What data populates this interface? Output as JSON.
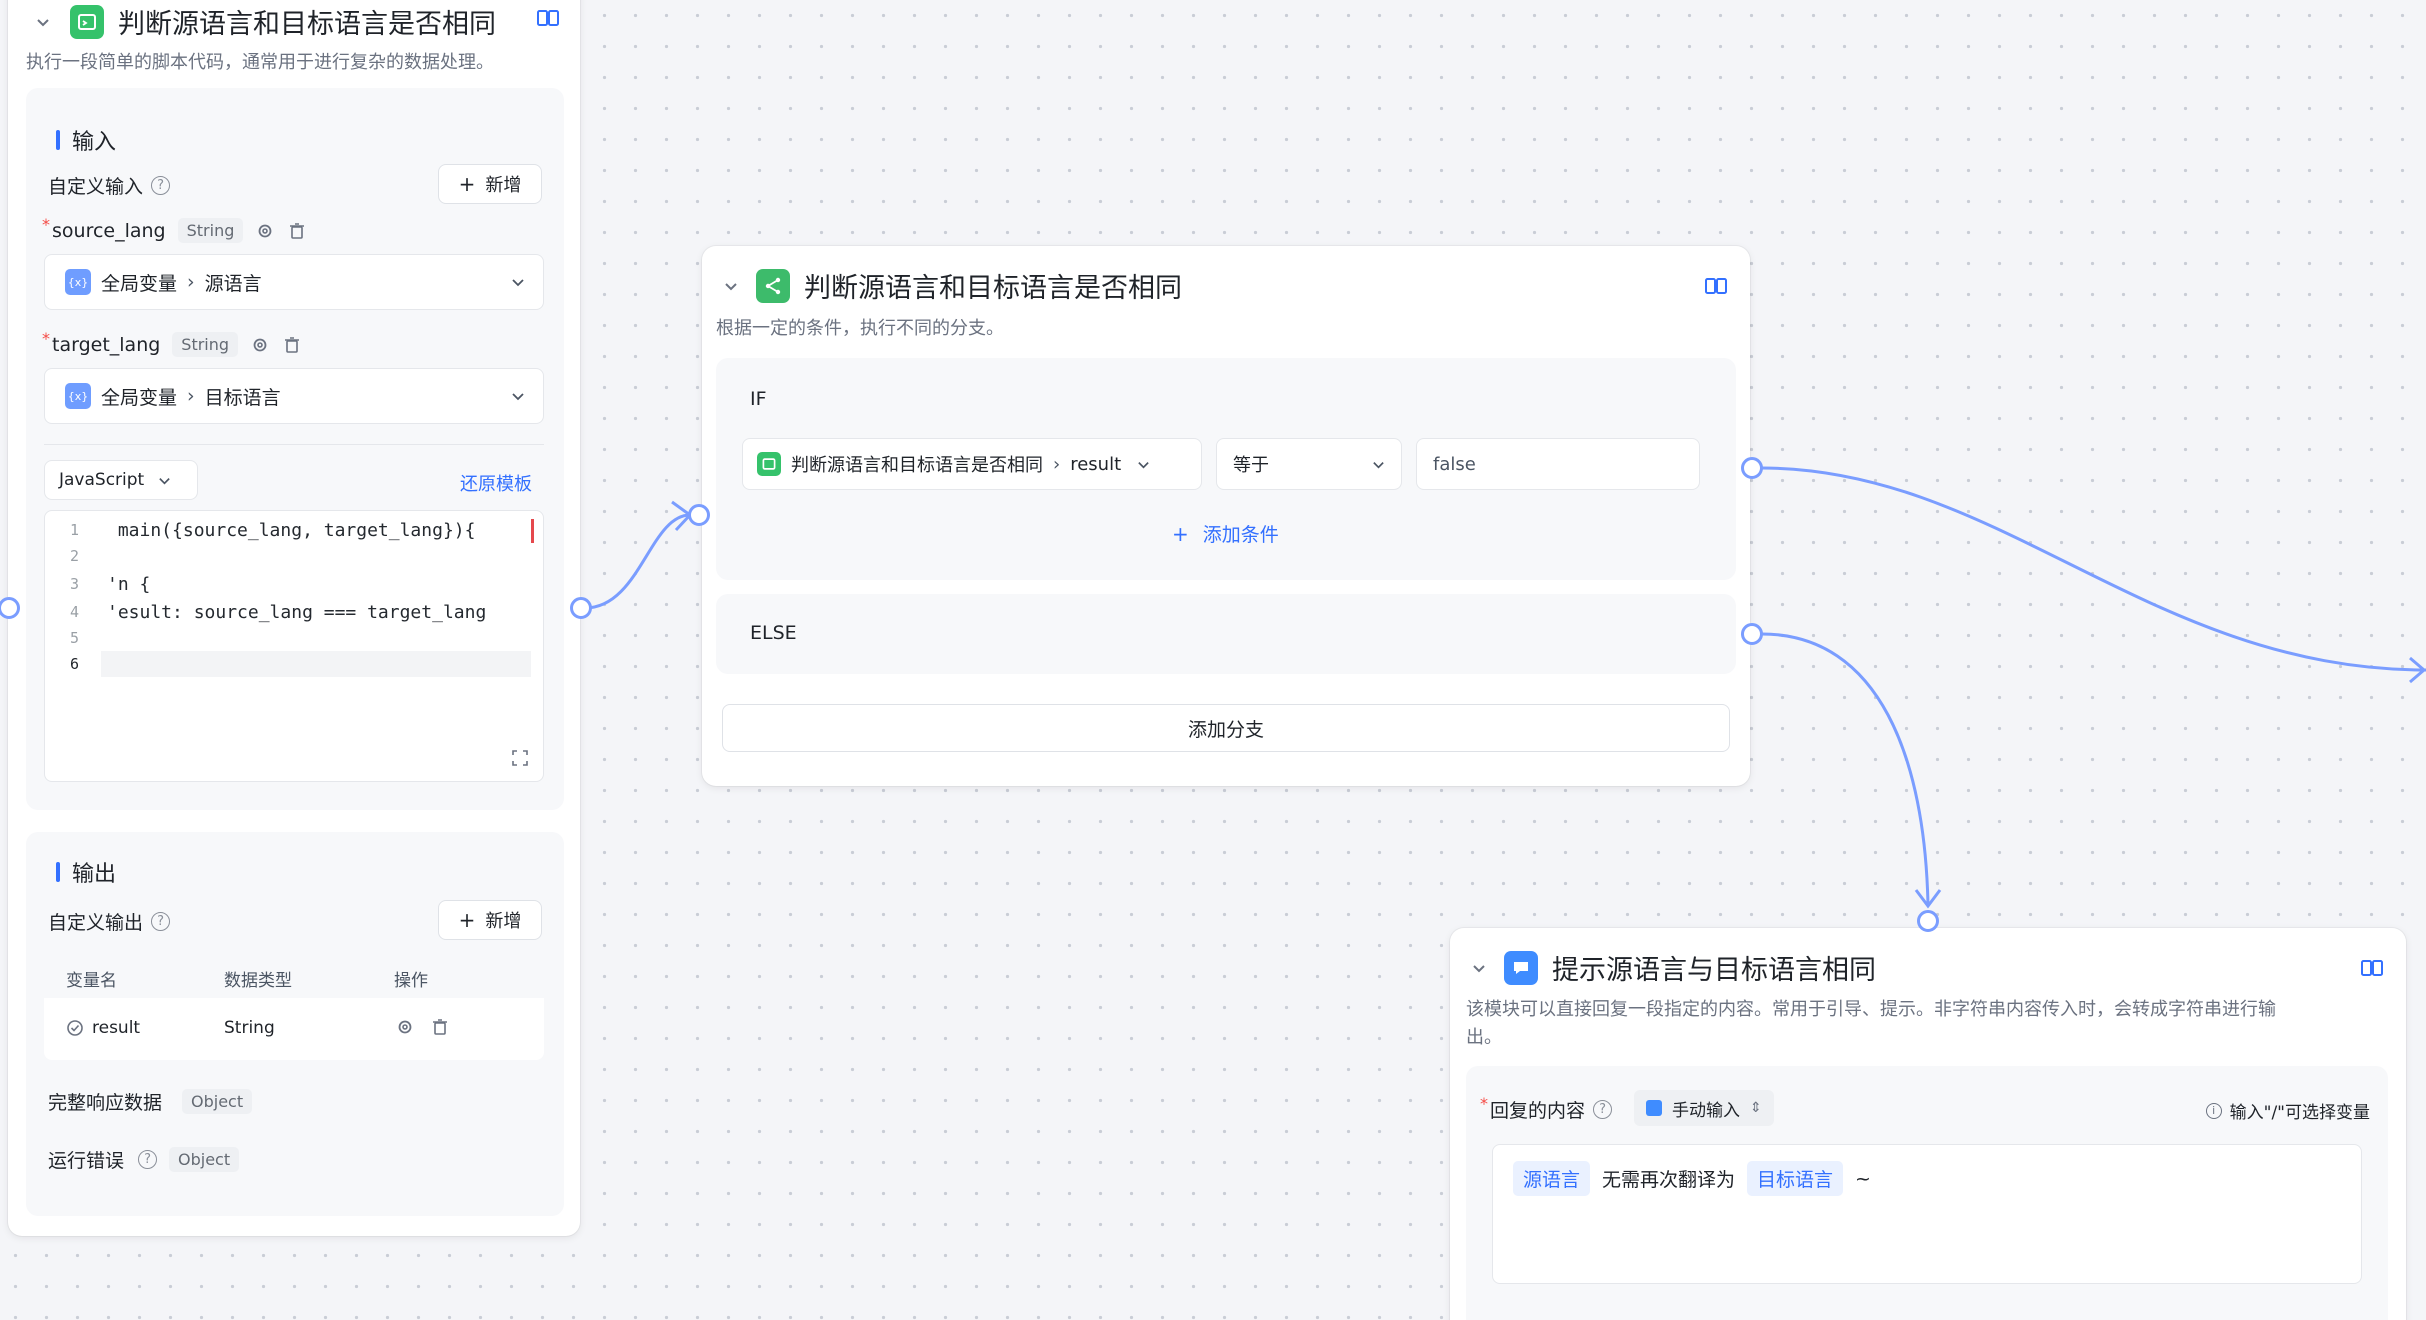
{
  "code_node": {
    "title": "判断源语言和目标语言是否相同",
    "description": "执行一段简单的脚本代码，通常用于进行复杂的数据处理。",
    "input_section": {
      "title": "输入",
      "custom_input_label": "自定义输入",
      "add_button": "新增",
      "variables": [
        {
          "name": "source_lang",
          "type": "String",
          "ref_scope": "全局变量",
          "ref_name": "源语言"
        },
        {
          "name": "target_lang",
          "type": "String",
          "ref_scope": "全局变量",
          "ref_name": "目标语言"
        }
      ],
      "language": "JavaScript",
      "restore_template": "还原模板",
      "code_lines": [
        {
          "n": "1",
          "text": " main({source_lang, target_lang}){"
        },
        {
          "n": "2",
          "text": ""
        },
        {
          "n": "3",
          "text": "'n {"
        },
        {
          "n": "4",
          "text": "'esult: source_lang === target_lang"
        },
        {
          "n": "5",
          "text": ""
        },
        {
          "n": "6",
          "text": ""
        }
      ]
    },
    "output_section": {
      "title": "输出",
      "custom_output_label": "自定义输出",
      "add_button": "新增",
      "columns": [
        "变量名",
        "数据类型",
        "操作"
      ],
      "rows": [
        {
          "name": "result",
          "type": "String"
        }
      ],
      "full_response_label": "完整响应数据",
      "full_response_type": "Object",
      "error_label": "运行错误",
      "error_type": "Object"
    }
  },
  "condition_node": {
    "title": "判断源语言和目标语言是否相同",
    "description": "根据一定的条件，执行不同的分支。",
    "if_label": "IF",
    "condition": {
      "ref_node": "判断源语言和目标语言是否相同",
      "ref_field": "result",
      "operator": "等于",
      "value": "false"
    },
    "add_condition": "添加条件",
    "else_label": "ELSE",
    "add_branch": "添加分支"
  },
  "reply_node": {
    "title": "提示源语言与目标语言相同",
    "description_line1": "该模块可以直接回复一段指定的内容。常用于引导、提示。非字符串内容传入时，会转成字符串进行输",
    "description_line2": "出。",
    "content_label": "回复的内容",
    "input_mode": "手动输入",
    "hint": "输入\"/\"可选择变量",
    "content": {
      "var1": "源语言",
      "text": "无需再次翻译为",
      "var2": "目标语言",
      "tail": "~"
    }
  },
  "colors": {
    "accent": "#3370ff",
    "edge": "#7a9dff",
    "code_icon": "#35c26b",
    "cond_icon": "#3dbb6b",
    "reply_icon": "#3f8cff"
  }
}
